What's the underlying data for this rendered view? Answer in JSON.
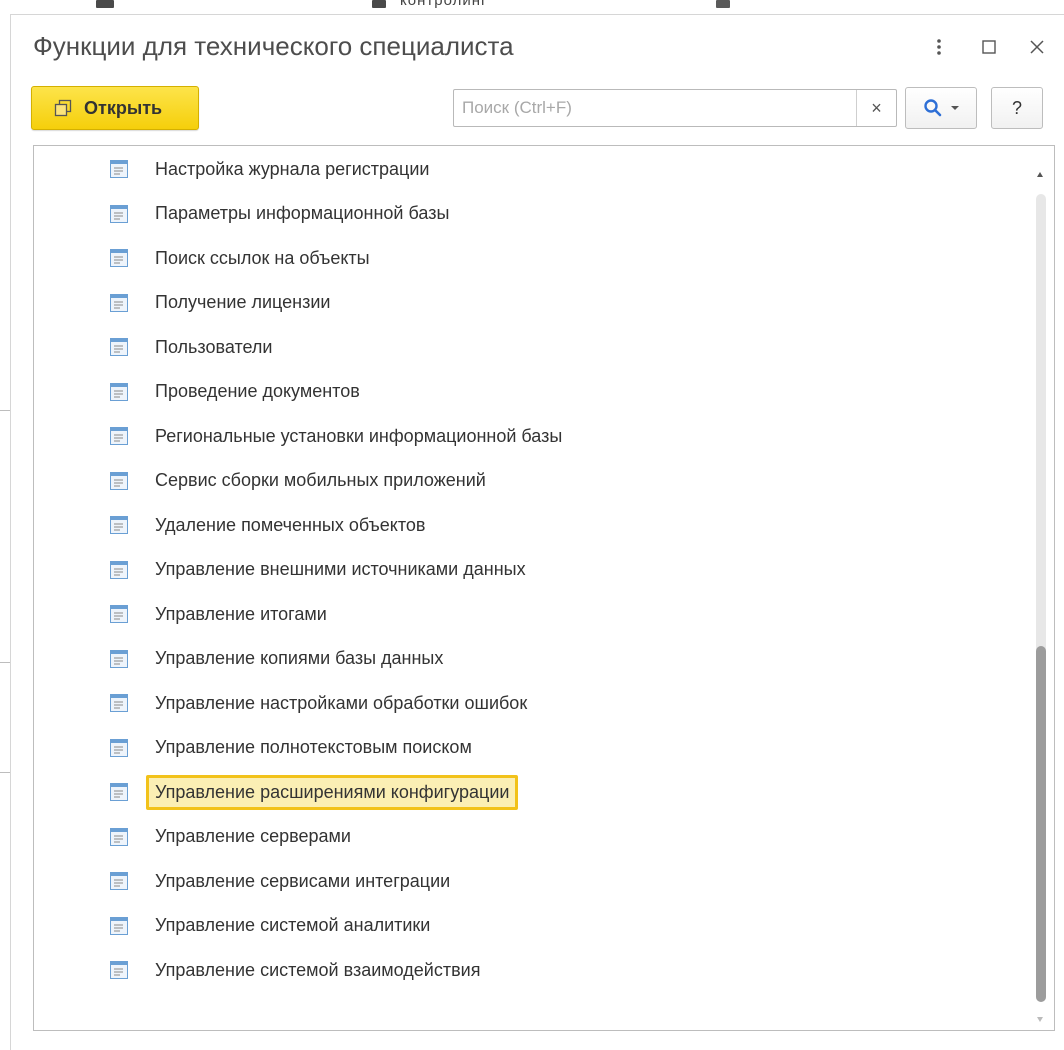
{
  "background": {
    "partial_text": "контролинг"
  },
  "dialog": {
    "title": "Функции для технического специалиста",
    "controls": {
      "more_label": "⋮",
      "maximize_label": "☐",
      "close_label": "✕"
    }
  },
  "toolbar": {
    "open_label": "Открыть",
    "search_placeholder": "Поиск (Ctrl+F)",
    "search_value": "",
    "clear_label": "×",
    "help_label": "?"
  },
  "list": {
    "items": [
      {
        "label": "Настройка журнала регистрации"
      },
      {
        "label": "Параметры информационной базы"
      },
      {
        "label": "Поиск ссылок на объекты"
      },
      {
        "label": "Получение лицензии"
      },
      {
        "label": "Пользователи"
      },
      {
        "label": "Проведение документов"
      },
      {
        "label": "Региональные установки информационной базы"
      },
      {
        "label": "Сервис сборки мобильных приложений"
      },
      {
        "label": "Удаление помеченных объектов"
      },
      {
        "label": "Управление внешними источниками данных"
      },
      {
        "label": "Управление итогами"
      },
      {
        "label": "Управление копиями базы данных"
      },
      {
        "label": "Управление настройками обработки ошибок"
      },
      {
        "label": "Управление полнотекстовым поиском"
      },
      {
        "label": "Управление расширениями конфигурации",
        "selected": true
      },
      {
        "label": "Управление серверами"
      },
      {
        "label": "Управление сервисами интеграции"
      },
      {
        "label": "Управление системой аналитики"
      },
      {
        "label": "Управление системой взаимодействия"
      }
    ],
    "selected_index": 14
  },
  "colors": {
    "accent_yellow": "#f5cf0b",
    "selection_fill": "#fbefb4",
    "selection_border": "#f2c21a",
    "search_icon_blue": "#2e6fd6"
  }
}
